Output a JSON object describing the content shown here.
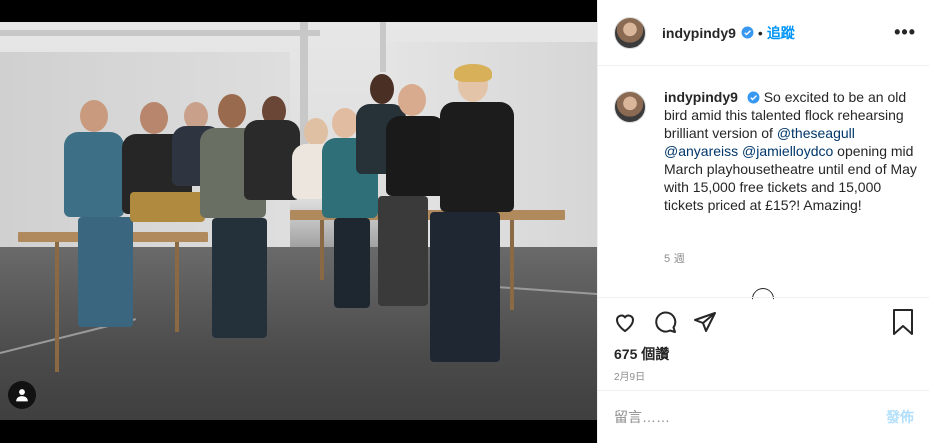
{
  "post": {
    "username": "indypindy9",
    "separator": "•",
    "follow_label": "追蹤",
    "more_label": "•••",
    "caption_text": "So excited to be an old bird amid this talented flock rehearsing brilliant version of",
    "mentions": [
      "@theseagull",
      "@anyareiss",
      "@jamielloydco"
    ],
    "caption_tail": "opening mid March playhousetheatre until end of May with 15,000 free tickets and 15,000 tickets priced at £15?! Amazing!",
    "age": "5 週",
    "likes": "675 個讚",
    "date": "2月9日"
  },
  "comment_box": {
    "placeholder": "留言……",
    "post_label": "發佈"
  },
  "icons": {
    "like": "heart-icon",
    "comment": "comment-bubble-icon",
    "share": "paper-plane-icon",
    "save": "bookmark-icon",
    "tags": "user-tag-icon",
    "verified": "verified-badge-icon",
    "more": "more-options-icon"
  },
  "colors": {
    "accent": "#0095f6",
    "verified": "#3897f0",
    "muted": "#8e8e8e",
    "post_disabled": "#b2dffc"
  }
}
